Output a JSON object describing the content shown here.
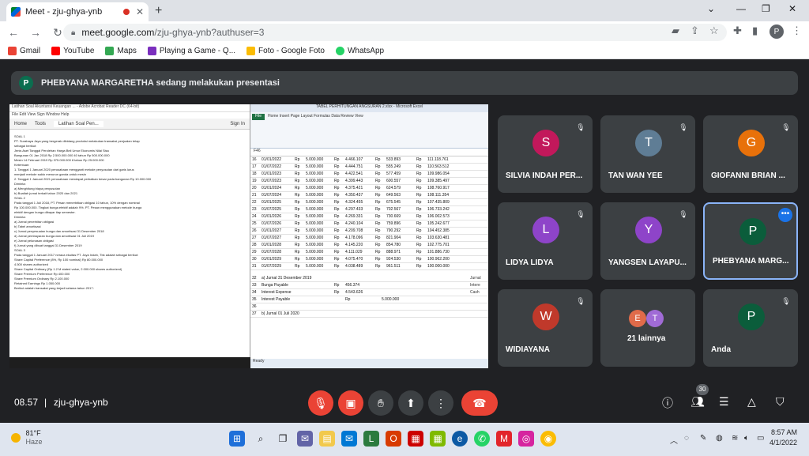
{
  "browser": {
    "tab_title": "Meet - zju-ghya-ynb",
    "url_host": "meet.google.com",
    "url_path": "/zju-ghya-ynb?authuser=3",
    "profile_initial": "P",
    "bookmarks": [
      {
        "label": "Gmail",
        "color": "#ea4335"
      },
      {
        "label": "YouTube",
        "color": "#ff0000"
      },
      {
        "label": "Maps",
        "color": "#34a853"
      },
      {
        "label": "Playing a Game - Q...",
        "color": "#7b2fbe"
      },
      {
        "label": "Foto - Google Foto",
        "color": "#fbbc04"
      },
      {
        "label": "WhatsApp",
        "color": "#25d366"
      }
    ]
  },
  "meet": {
    "presenter_initial": "P",
    "banner_text": "PHEBYANA MARGARETHA sedang melakukan presentasi",
    "time": "08.57",
    "meeting_code": "zju-ghya-ynb",
    "people_count": "30",
    "participants": [
      {
        "initial": "S",
        "name": "SILVIA INDAH PER...",
        "color": "#c2185b"
      },
      {
        "initial": "T",
        "name": "TAN WAN YEE",
        "color": "#5f7d95"
      },
      {
        "initial": "G",
        "name": "GIOFANNI BRIAN ...",
        "color": "#e8710a"
      },
      {
        "initial": "L",
        "name": "LIDYA LIDYA",
        "color": "#8e44c9"
      },
      {
        "initial": "Y",
        "name": "YANGSEN LAYAPU...",
        "color": "#8e44c9"
      },
      {
        "initial": "P",
        "name": "PHEBYANA MARG...",
        "color": "#0b5d3b"
      },
      {
        "initial": "W",
        "name": "WIDIAYANA",
        "color": "#c0392b"
      },
      {
        "initial": "",
        "name": "21 lainnya",
        "color": "#3c4043"
      },
      {
        "initial": "P",
        "name": "Anda",
        "color": "#0b5d3b"
      }
    ],
    "others_avatars": [
      {
        "initial": "E",
        "color": "#e06b4a"
      },
      {
        "initial": "T",
        "color": "#a06bd6"
      }
    ]
  },
  "shared_screen": {
    "pdf_title": "Latihan Soal Akuntansi Keuangan ... - Adobe Acrobat Reader DC (64-bit)",
    "pdf_menu": "File  Edit  View  Sign  Window  Help",
    "pdf_tabs": [
      "Home",
      "Tools",
      "Latihan Soal Pen..."
    ],
    "pdf_signin": "Sign In",
    "pdf_lines": [
      "SOAL 1",
      "PT. Surabaya Jaya yang bergerak dibidang produksi melakukan transaksi penjualan tetap",
      "sebagai berikut:",
      "Jenis Aset   Tanggal Perolehan   Harga Beli   Umur Ekonomis   Nilai Sisa",
      "Bangunan     01 Jan 2018        Rp 2.500.000.000   40 tahun   Rp 500.000.000",
      "Mesin        14 Februari 2019   Rp 375.000.000    8 tahun    Rp 25.000.000",
      "Ketentuan:",
      "1. Tanggal 1 Januari 2020 perusahaan mengganti metode penyusutan dari garis lurus",
      "   menjadi metode saldo menurun ganda untuk mesin",
      "2. Tanggal 1 Januari 2021 perusahaan mendapat perbaikan besar pada bangunan Rp 10.000.000",
      "Diminta:",
      "a) Menghitung biaya penyusutan",
      "b) Buatlah jurnal terkait tahun 2020 dan 2021",
      "SOAL 2",
      "Pada tanggal 1 Juli 2018, PT. Pesan menerbitkan obligasi 10 tahun, 10% dengan nominal",
      "Rp 100.000.000. Tingkat bunga efektif adalah 9%. PT. Pesan menggunakan metode bunga",
      "efektif dengan bunga dibayar tiap semester.",
      "Diminta:",
      "a) Jurnal penerbitan obligasi",
      "b) Tabel amortisasi",
      "c) Jurnal penyesuaian bunga dan amortisasi 31 Desember 2018",
      "d) Jurnal pembayaran bunga dan amortisasi 01 Juli 2019",
      "e) Jurnal pelunasan obligasi",
      "f) Jurnal yang dibuat tanggal 31 Desember 2019",
      "SOAL 3",
      "Pada tanggal 1 Januari 2017 neraca ekuitas PT. Jaya Indah, Tbk adalah sebagai berikut:",
      "Share Capital Preference (8%, Rp 100 nominal)              Rp 80.000.000",
      "4.500 shares authorized",
      "Share Capital Ordinary (Rp 1.2 M stated value, 2.000.000 shares authorized)",
      "Share Premium Preference                                    Rp 400.000",
      "Share Premium Ordinary                                      Rp 2.100.000",
      "Retained Earnings                                           Rp 1.050.000",
      "Berikut adalah transaksi yang terjadi selama tahun 2017:"
    ],
    "excel_title": "TABEL PERHITUNGAN ANGSURAN 2.xlsx - Microsoft Excel",
    "excel_file_tab": "File",
    "excel_ribbon_tabs": "Home   Insert   Page Layout   Formulas   Data   Review   View",
    "excel_namebox": "F46",
    "excel_rows": [
      [
        "16",
        "01/01/2022",
        "Rp",
        "5.000.000",
        "Rp",
        "4.466.107",
        "Rp",
        "533.893",
        "Rp",
        "111.118.761"
      ],
      [
        "17",
        "01/07/2022",
        "Rp",
        "5.000.000",
        "Rp",
        "4.444.751",
        "Rp",
        "555.249",
        "Rp",
        "110.563.512"
      ],
      [
        "18",
        "01/01/2023",
        "Rp",
        "5.000.000",
        "Rp",
        "4.422.541",
        "Rp",
        "577.459",
        "Rp",
        "109.986.054"
      ],
      [
        "19",
        "01/07/2023",
        "Rp",
        "5.000.000",
        "Rp",
        "4.399.443",
        "Rp",
        "600.557",
        "Rp",
        "109.385.497"
      ],
      [
        "20",
        "01/01/2024",
        "Rp",
        "5.000.000",
        "Rp",
        "4.375.421",
        "Rp",
        "624.579",
        "Rp",
        "108.760.917"
      ],
      [
        "21",
        "01/07/2024",
        "Rp",
        "5.000.000",
        "Rp",
        "4.350.437",
        "Rp",
        "649.563",
        "Rp",
        "108.111.354"
      ],
      [
        "22",
        "01/01/2025",
        "Rp",
        "5.000.000",
        "Rp",
        "4.324.455",
        "Rp",
        "675.545",
        "Rp",
        "107.435.809"
      ],
      [
        "23",
        "01/07/2025",
        "Rp",
        "5.000.000",
        "Rp",
        "4.297.433",
        "Rp",
        "702.567",
        "Rp",
        "106.733.242"
      ],
      [
        "24",
        "01/01/2026",
        "Rp",
        "5.000.000",
        "Rp",
        "4.269.331",
        "Rp",
        "730.669",
        "Rp",
        "106.002.573"
      ],
      [
        "25",
        "01/07/2026",
        "Rp",
        "5.000.000",
        "Rp",
        "4.240.104",
        "Rp",
        "759.896",
        "Rp",
        "105.242.677"
      ],
      [
        "26",
        "01/01/2027",
        "Rp",
        "5.000.000",
        "Rp",
        "4.209.708",
        "Rp",
        "790.292",
        "Rp",
        "104.452.385"
      ],
      [
        "27",
        "01/07/2027",
        "Rp",
        "5.000.000",
        "Rp",
        "4.178.096",
        "Rp",
        "821.904",
        "Rp",
        "103.630.481"
      ],
      [
        "28",
        "01/01/2028",
        "Rp",
        "5.000.000",
        "Rp",
        "4.145.220",
        "Rp",
        "854.780",
        "Rp",
        "102.775.701"
      ],
      [
        "29",
        "01/07/2028",
        "Rp",
        "5.000.000",
        "Rp",
        "4.111.029",
        "Rp",
        "888.971",
        "Rp",
        "101.886.730"
      ],
      [
        "30",
        "01/01/2029",
        "Rp",
        "5.000.000",
        "Rp",
        "4.075.470",
        "Rp",
        "924.530",
        "Rp",
        "100.962.200"
      ],
      [
        "31",
        "01/07/2029",
        "Rp",
        "5.000.000",
        "Rp",
        "4.038.489",
        "Rp",
        "961.511",
        "Rp",
        "100.000.000"
      ]
    ],
    "excel_journal": [
      [
        "32",
        "a) Jurnal 31 Desember 2019",
        "",
        "",
        ""
      ],
      [
        "33",
        "Bunga Payable",
        "Rp",
        "456.374",
        ""
      ],
      [
        "34",
        "Interest Expense",
        "Rp",
        "4.543.626",
        ""
      ],
      [
        "35",
        "Interest Payable",
        "",
        "Rp",
        "5.000.000"
      ],
      [
        "36",
        "",
        "",
        "",
        ""
      ],
      [
        "37",
        "b) Jurnal 01 Juli 2020",
        "",
        "",
        ""
      ]
    ],
    "excel_side_labels": [
      "Jurnal",
      "Intere",
      "Cash"
    ],
    "excel_status": "Ready"
  },
  "taskbar": {
    "temperature": "81°F",
    "weather": "Haze",
    "time": "8:57 AM",
    "date": "4/1/2022"
  }
}
